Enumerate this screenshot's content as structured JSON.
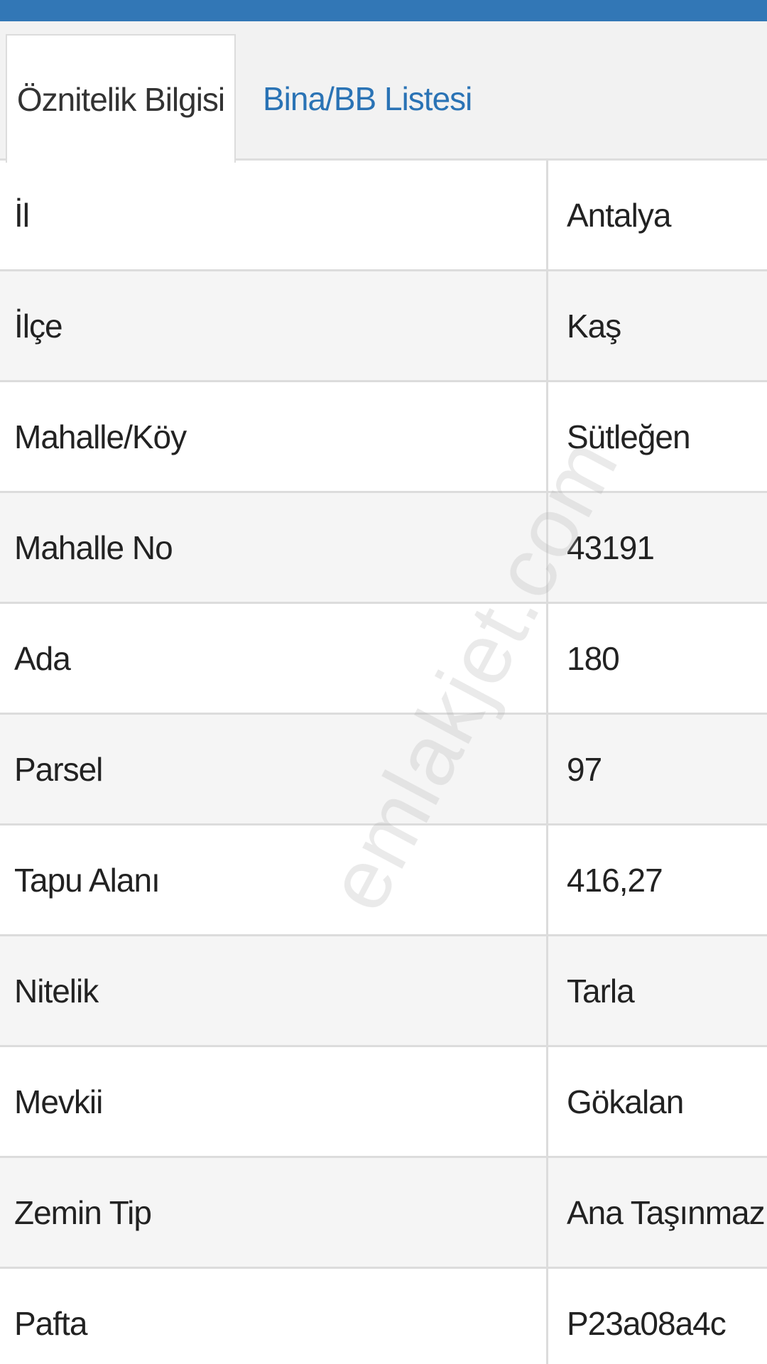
{
  "tabs": [
    {
      "label": "Öznitelik Bilgisi",
      "active": true
    },
    {
      "label": "Bina/BB Listesi",
      "active": false
    }
  ],
  "rows": [
    {
      "key": "İl",
      "value": "Antalya"
    },
    {
      "key": "İlçe",
      "value": "Kaş"
    },
    {
      "key": "Mahalle/Köy",
      "value": "Sütleğen"
    },
    {
      "key": "Mahalle No",
      "value": "43191"
    },
    {
      "key": "Ada",
      "value": "180"
    },
    {
      "key": "Parsel",
      "value": "97"
    },
    {
      "key": "Tapu Alanı",
      "value": "416,27"
    },
    {
      "key": "Nitelik",
      "value": "Tarla"
    },
    {
      "key": "Mevkii",
      "value": "Gökalan"
    },
    {
      "key": "Zemin Tip",
      "value": "Ana Taşınmaz"
    },
    {
      "key": "Pafta",
      "value": "P23a08a4c"
    }
  ],
  "watermark": "emlakjet.com",
  "colors": {
    "top_bar": "#3277b6",
    "tab_link": "#2a73b5",
    "border": "#dcdcdc"
  }
}
